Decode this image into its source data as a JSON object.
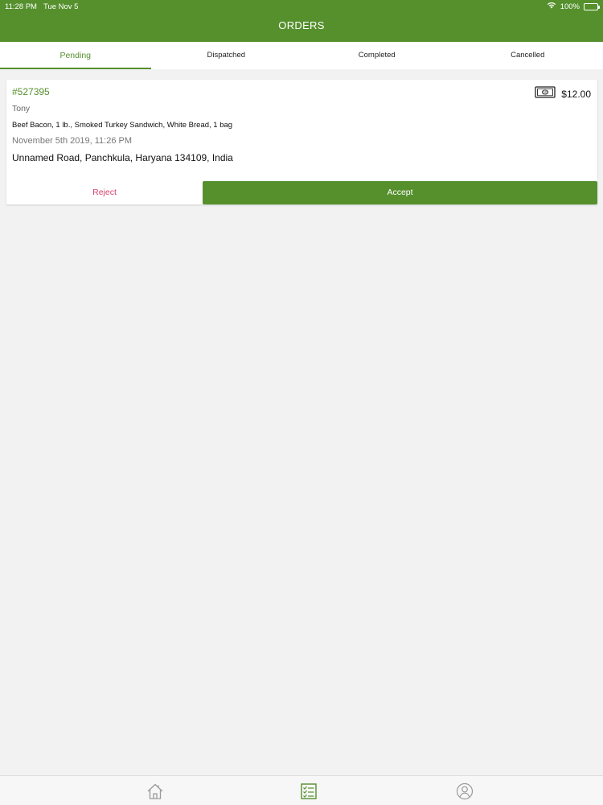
{
  "status_bar": {
    "time": "11:28 PM",
    "date": "Tue Nov 5",
    "battery": "100%",
    "icons": [
      "wifi-icon",
      "battery-icon"
    ]
  },
  "header": {
    "title": "ORDERS"
  },
  "tabs": [
    {
      "label": "Pending",
      "active": true
    },
    {
      "label": "Dispatched",
      "active": false
    },
    {
      "label": "Completed",
      "active": false
    },
    {
      "label": "Cancelled",
      "active": false
    }
  ],
  "order": {
    "id": "#527395",
    "price": "$12.00",
    "payment_icon": "cash-icon",
    "customer": "Tony",
    "items": "Beef Bacon, 1 lb., Smoked Turkey Sandwich, White Bread, 1 bag",
    "date": "November 5th 2019, 11:26 PM",
    "address": "Unnamed Road, Panchkula, Haryana 134109, India",
    "reject_label": "Reject",
    "accept_label": "Accept"
  },
  "bottom_nav": [
    {
      "icon": "home-icon",
      "active": false
    },
    {
      "icon": "orders-list-icon",
      "active": true
    },
    {
      "icon": "profile-icon",
      "active": false
    }
  ],
  "colors": {
    "brand": "#55902d",
    "reject": "#d8426d",
    "background": "#f2f2f2"
  }
}
